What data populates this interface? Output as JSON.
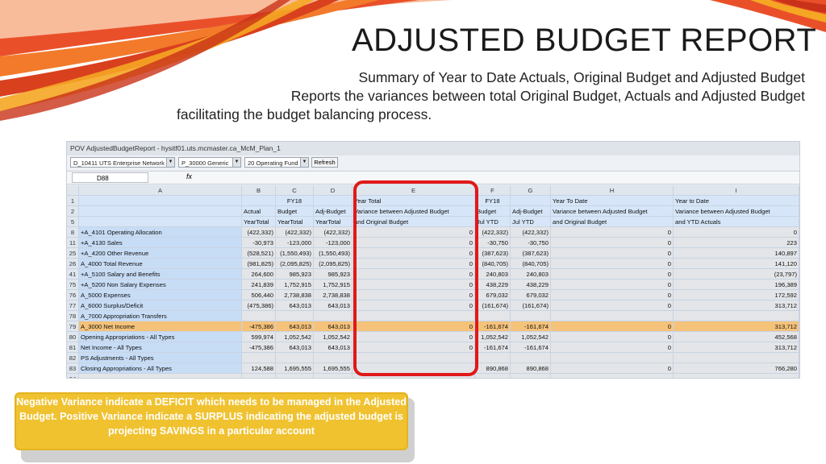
{
  "title": "ADJUSTED BUDGET REPORT",
  "subtitle_lines": [
    "Summary of Year to Date Actuals, Original Budget and Adjusted Budget",
    "Reports the variances between total Original Budget, Actuals  and Adjusted Budget",
    "facilitating the budget balancing process."
  ],
  "spreadsheet": {
    "pov_label": "POV AdjustedBudgetReport - hysitf01.uts.mcmaster.ca_McM_Plan_1",
    "combos": [
      "D_10411 UTS Enterprise Network",
      "P_30000 Generic",
      "20 Operating Fund"
    ],
    "refresh_label": "Refresh",
    "name_box": "D88",
    "fx_label": "fx",
    "columns": [
      "A",
      "B",
      "C",
      "D",
      "E",
      "F",
      "G",
      "H",
      "I"
    ],
    "header_rows": {
      "row1": {
        "num": "1",
        "C": "FY18",
        "E": "Year Total",
        "F": "FY18",
        "H": "Year To Date",
        "I": "Year to Date"
      },
      "row2": {
        "num": "2",
        "B": "Actual",
        "C": "Budget",
        "D": "Adj-Budget",
        "E": "Variance between Adjusted Budget",
        "F": "Budget",
        "G": "Adj-Budget",
        "H": "Variance between Adjusted Budget",
        "I": "Variance between Adjusted Budget"
      },
      "row3": {
        "num": "5",
        "B": "YearTotal",
        "C": "YearTotal",
        "D": "YearTotal",
        "E": "and Original Budget",
        "F": "Jul YTD",
        "G": "Jul YTD",
        "H": "and Original Budget",
        "I": "and YTD Actuals"
      }
    },
    "rows": [
      {
        "num": "8",
        "label": "+A_4101 Operating Allocation",
        "B": "(422,332)",
        "C": "(422,332)",
        "D": "(422,332)",
        "E": "0",
        "F": "(422,332)",
        "G": "(422,332)",
        "H": "0",
        "I": "0",
        "style": "blue"
      },
      {
        "num": "11",
        "label": "+A_4130 Sales",
        "B": "-30,973",
        "C": "-123,000",
        "D": "-123,000",
        "E": "0",
        "F": "-30,750",
        "G": "-30,750",
        "H": "0",
        "I": "223",
        "style": "blue"
      },
      {
        "num": "25",
        "label": "+A_4200 Other Revenue",
        "B": "(528,521)",
        "C": "(1,550,493)",
        "D": "(1,550,493)",
        "E": "0",
        "F": "(387,623)",
        "G": "(387,623)",
        "H": "0",
        "I": "140,897",
        "style": "blue"
      },
      {
        "num": "26",
        "label": "A_4000 Total Revenue",
        "B": "(981,825)",
        "C": "(2,095,825)",
        "D": "(2,095,825)",
        "E": "0",
        "F": "(840,705)",
        "G": "(840,705)",
        "H": "0",
        "I": "141,120",
        "style": "blue"
      },
      {
        "num": "41",
        "label": "+A_5100 Salary and Benefits",
        "B": "264,600",
        "C": "985,923",
        "D": "985,923",
        "E": "0",
        "F": "240,803",
        "G": "240,803",
        "H": "0",
        "I": "(23,797)",
        "style": "blue"
      },
      {
        "num": "75",
        "label": "+A_5200 Non Salary Expenses",
        "B": "241,839",
        "C": "1,752,915",
        "D": "1,752,915",
        "E": "0",
        "F": "438,229",
        "G": "438,229",
        "H": "0",
        "I": "196,389",
        "style": "blue"
      },
      {
        "num": "76",
        "label": "A_5000 Expenses",
        "B": "506,440",
        "C": "2,738,838",
        "D": "2,738,838",
        "E": "0",
        "F": "679,032",
        "G": "679,032",
        "H": "0",
        "I": "172,592",
        "style": "blue"
      },
      {
        "num": "77",
        "label": "A_6000 Surplus/Deficit",
        "B": "(475,386)",
        "C": "643,013",
        "D": "643,013",
        "E": "0",
        "F": "(161,674)",
        "G": "(161,674)",
        "H": "0",
        "I": "313,712",
        "style": "blue"
      },
      {
        "num": "78",
        "label": "A_7000 Appropriation Transfers",
        "B": "",
        "C": "",
        "D": "",
        "E": "",
        "F": "",
        "G": "",
        "H": "",
        "I": "",
        "style": "blue"
      },
      {
        "num": "79",
        "label": "A_3000 Net Income",
        "B": "-475,386",
        "C": "643,013",
        "D": "643,013",
        "E": "0",
        "F": "-161,674",
        "G": "-161,674",
        "H": "0",
        "I": "313,712",
        "style": "orange"
      },
      {
        "num": "80",
        "label": "Opening Appropriations - All Types",
        "B": "599,974",
        "C": "1,052,542",
        "D": "1,052,542",
        "E": "0",
        "F": "1,052,542",
        "G": "1,052,542",
        "H": "0",
        "I": "452,568",
        "style": "blue"
      },
      {
        "num": "81",
        "label": "Net Income - All Types",
        "B": "-475,386",
        "C": "643,013",
        "D": "643,013",
        "E": "0",
        "F": "-161,674",
        "G": "-161,674",
        "H": "0",
        "I": "313,712",
        "style": "blue"
      },
      {
        "num": "82",
        "label": "PS Adjustments - All Types",
        "B": "",
        "C": "",
        "D": "",
        "E": "",
        "F": "",
        "G": "",
        "H": "",
        "I": "",
        "style": "blue"
      },
      {
        "num": "83",
        "label": "Closing Appropriations - All Types",
        "B": "124,588",
        "C": "1,695,555",
        "D": "1,695,555",
        "E": "",
        "F": "890,868",
        "G": "890,868",
        "H": "0",
        "I": "766,280",
        "style": "blue"
      },
      {
        "num": "84",
        "label": "",
        "B": "",
        "C": "",
        "D": "",
        "E": "",
        "F": "",
        "G": "",
        "H": "",
        "I": "",
        "style": "blank"
      }
    ]
  },
  "callout_text": "Negative Variance indicate a DEFICIT which needs to be managed in the Adjusted Budget. Positive Variance indicate a SURPLUS indicating the adjusted budget is projecting SAVINGS in a particular account",
  "colors": {
    "accent_red": "#e01919",
    "callout_yellow": "#f0c230",
    "highlight_orange": "#f5c27a",
    "cell_blue": "#c7dcf5"
  }
}
